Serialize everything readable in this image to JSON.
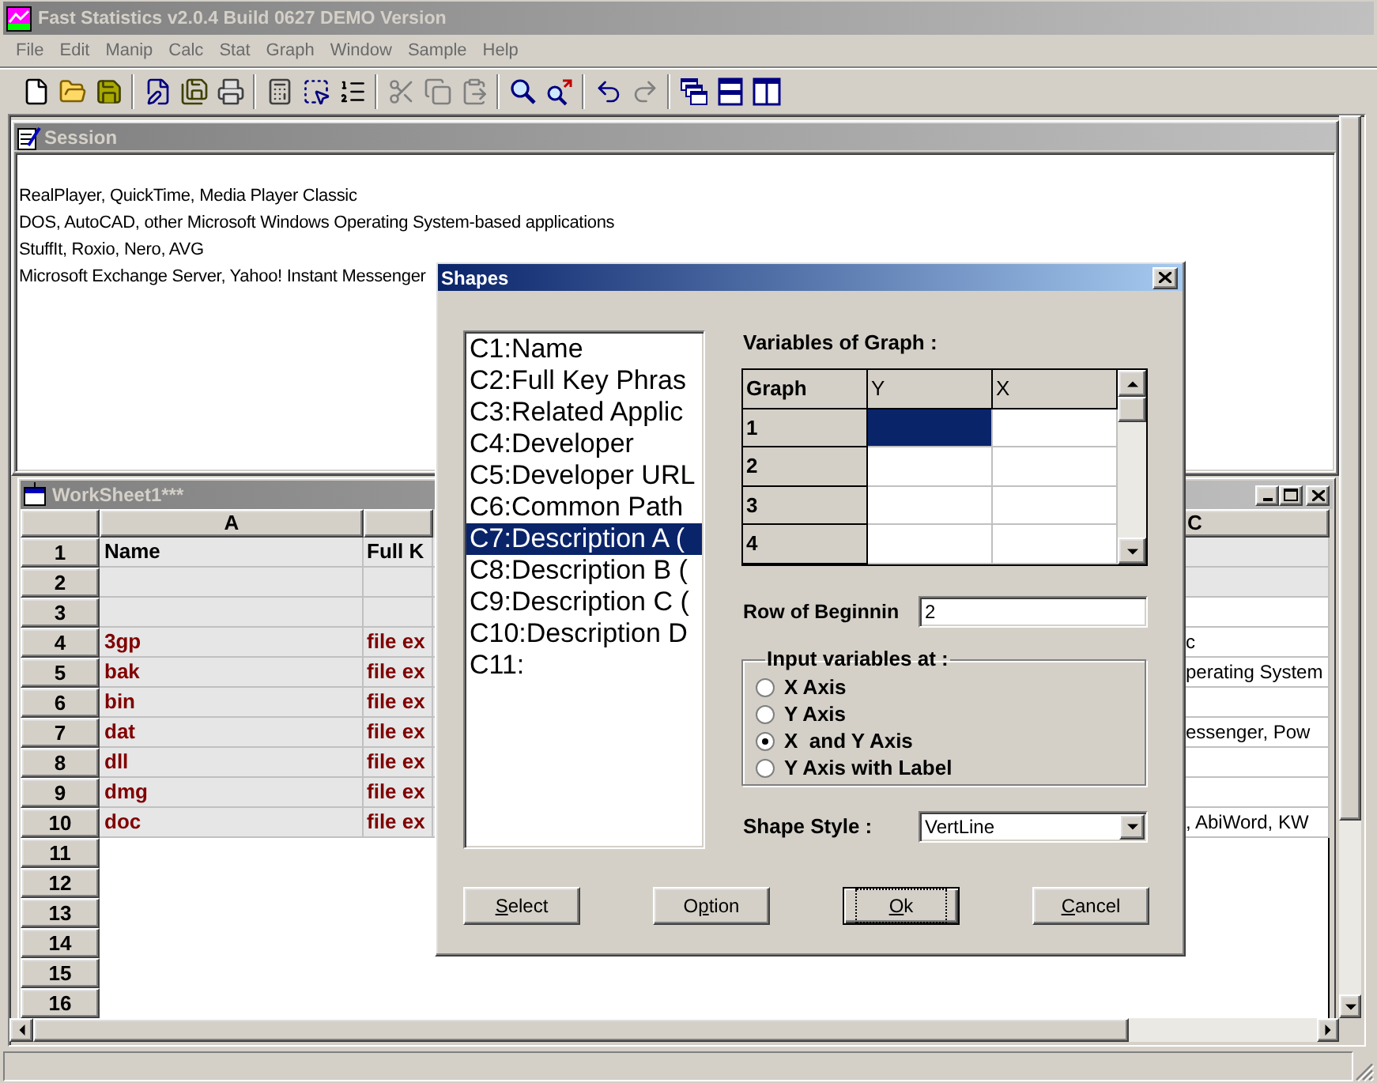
{
  "window": {
    "title": "Fast Statistics v2.0.4 Build 0627 DEMO Version"
  },
  "menu": [
    "File",
    "Edit",
    "Manip",
    "Calc",
    "Stat",
    "Graph",
    "Window",
    "Sample",
    "Help"
  ],
  "toolbar": {
    "groups": [
      [
        {
          "disabled": false
        },
        {
          "disabled": false
        },
        {
          "disabled": false
        }
      ],
      [
        {
          "disabled": false
        },
        {
          "disabled": false
        },
        {
          "disabled": false
        }
      ],
      [
        {
          "disabled": false
        },
        {
          "disabled": false
        },
        {
          "disabled": false
        }
      ],
      [
        {
          "disabled": true
        },
        {
          "disabled": true
        },
        {
          "disabled": true
        }
      ],
      [
        {
          "disabled": false
        },
        {
          "disabled": false
        }
      ],
      [
        {
          "disabled": false
        },
        {
          "disabled": true
        }
      ],
      [
        {
          "disabled": false
        },
        {
          "disabled": false
        },
        {
          "disabled": false
        }
      ]
    ]
  },
  "session": {
    "title": "Session",
    "lines": [
      "RealPlayer, QuickTime, Media Player Classic",
      "DOS, AutoCAD, other Microsoft Windows Operating System-based applications",
      "StuffIt, Roxio, Nero, AVG",
      "Microsoft Exchange Server, Yahoo! Instant Messenger"
    ]
  },
  "worksheet": {
    "title": "WorkSheet1***",
    "columns": [
      {
        "label": "A"
      },
      {},
      {
        "label": "C"
      }
    ],
    "rows": [
      {
        "label": "1",
        "cells": [
          {
            "text": "Name",
            "kind": "label",
            "shaded": true
          },
          {
            "text": "Full K",
            "kind": "label",
            "shaded": true
          },
          {
            "shaded": true
          }
        ]
      },
      {
        "label": "2",
        "cells": [
          {
            "shaded": true
          },
          {
            "shaded": true
          },
          {
            "shaded": true
          }
        ]
      },
      {
        "label": "3",
        "cells": [
          {
            "shaded": true
          },
          {
            "shaded": true
          },
          {
            "shaded": false
          }
        ]
      },
      {
        "label": "4",
        "cells": [
          {
            "text": "3gp",
            "kind": "value",
            "shaded": true
          },
          {
            "text": "file ex",
            "kind": "value",
            "shaded": true
          },
          {
            "text": "c",
            "kind": "plain",
            "shaded": false
          }
        ]
      },
      {
        "label": "5",
        "cells": [
          {
            "text": "bak",
            "kind": "value",
            "shaded": true
          },
          {
            "text": "file ex",
            "kind": "value",
            "shaded": true
          },
          {
            "text": "perating System",
            "kind": "plain",
            "shaded": false
          }
        ]
      },
      {
        "label": "6",
        "cells": [
          {
            "text": "bin",
            "kind": "value",
            "shaded": true
          },
          {
            "text": "file ex",
            "kind": "value",
            "shaded": true
          },
          {
            "shaded": false
          }
        ]
      },
      {
        "label": "7",
        "cells": [
          {
            "text": "dat",
            "kind": "value",
            "shaded": true
          },
          {
            "text": "file ex",
            "kind": "value",
            "shaded": true
          },
          {
            "text": "essenger, Pow",
            "kind": "plain",
            "shaded": false
          }
        ]
      },
      {
        "label": "8",
        "cells": [
          {
            "text": "dll",
            "kind": "value",
            "shaded": true
          },
          {
            "text": "file ex",
            "kind": "value",
            "shaded": true
          },
          {
            "shaded": false
          }
        ]
      },
      {
        "label": "9",
        "cells": [
          {
            "text": "dmg",
            "kind": "value",
            "shaded": true
          },
          {
            "text": "file ex",
            "kind": "value",
            "shaded": true
          },
          {
            "shaded": false
          }
        ]
      },
      {
        "label": "10",
        "cells": [
          {
            "text": "doc",
            "kind": "value",
            "shaded": true
          },
          {
            "text": "file ex",
            "kind": "value",
            "shaded": true
          },
          {
            "text": ", AbiWord, KW",
            "kind": "plain",
            "shaded": false
          }
        ]
      },
      {
        "label": "11"
      },
      {
        "label": "12"
      },
      {
        "label": "13"
      },
      {
        "label": "14"
      },
      {
        "label": "15"
      },
      {
        "label": "16"
      }
    ]
  },
  "dialog": {
    "title": "Shapes",
    "list": [
      {
        "label": "C1:Name",
        "selected": false
      },
      {
        "label": "C2:Full Key Phras",
        "selected": false
      },
      {
        "label": "C3:Related Applic",
        "selected": false
      },
      {
        "label": "C4:Developer",
        "selected": false
      },
      {
        "label": "C5:Developer URL",
        "selected": false
      },
      {
        "label": "C6:Common Path",
        "selected": false
      },
      {
        "label": "C7:Description A (",
        "selected": true
      },
      {
        "label": "C8:Description B (",
        "selected": false
      },
      {
        "label": "C9:Description C (",
        "selected": false
      },
      {
        "label": "C10:Description D",
        "selected": false
      },
      {
        "label": "C11:",
        "selected": false
      }
    ],
    "variables": {
      "label": "Variables of Graph :",
      "columns": [
        "Graph",
        "Y",
        "X"
      ],
      "rows": [
        {
          "label": "1",
          "cells": [
            {
              "selected": true
            },
            {
              "selected": false
            }
          ]
        },
        {
          "label": "2",
          "cells": [
            {
              "selected": false
            },
            {
              "selected": false
            }
          ]
        },
        {
          "label": "3",
          "cells": [
            {
              "selected": false
            },
            {
              "selected": false
            }
          ]
        },
        {
          "label": "4",
          "cells": [
            {
              "selected": false
            },
            {
              "selected": false
            }
          ]
        }
      ]
    },
    "row_of_beginning": {
      "label": "Row of Beginnin",
      "value": "2"
    },
    "input_variables": {
      "label": "Input variables at :",
      "options": [
        {
          "label": "X Axis",
          "selected": false
        },
        {
          "label": "Y Axis",
          "selected": false
        },
        {
          "label": "X  and Y Axis",
          "selected": true
        },
        {
          "label": "Y Axis with Label",
          "selected": false
        }
      ]
    },
    "shape_style": {
      "label": "Shape Style :",
      "value": "VertLine"
    },
    "buttons": [
      {
        "access_key": "S",
        "rest": "elect",
        "default": false
      },
      {
        "before": "O",
        "access_key": "p",
        "rest": "tion",
        "default": false
      },
      {
        "access_key": "O",
        "rest": "k",
        "default": true
      },
      {
        "access_key": "C",
        "rest": "ancel",
        "default": false
      }
    ]
  }
}
